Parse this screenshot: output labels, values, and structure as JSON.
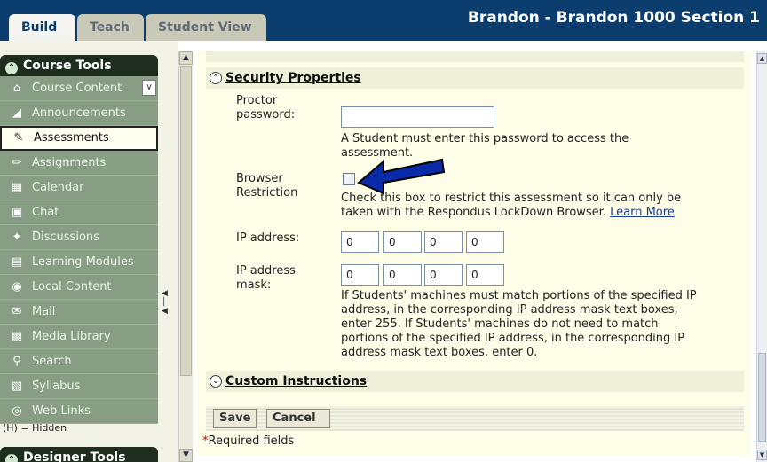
{
  "tabs": [
    {
      "label": "Build"
    },
    {
      "label": "Teach"
    },
    {
      "label": "Student View"
    }
  ],
  "course_title": "Brandon - Brandon 1000 Section 1",
  "sidebar": {
    "header": "Course Tools",
    "items": [
      {
        "label": "Course Content",
        "icon": "home-icon"
      },
      {
        "label": "Announcements",
        "icon": "megaphone-icon"
      },
      {
        "label": "Assessments",
        "icon": "assessment-icon"
      },
      {
        "label": "Assignments",
        "icon": "pencil-icon"
      },
      {
        "label": "Calendar",
        "icon": "calendar-icon"
      },
      {
        "label": "Chat",
        "icon": "chat-icon"
      },
      {
        "label": "Discussions",
        "icon": "pushpin-icon"
      },
      {
        "label": "Learning Modules",
        "icon": "modules-icon"
      },
      {
        "label": "Local Content",
        "icon": "disc-icon"
      },
      {
        "label": "Mail",
        "icon": "mail-icon"
      },
      {
        "label": "Media Library",
        "icon": "media-icon"
      },
      {
        "label": "Search",
        "icon": "magnifier-icon"
      },
      {
        "label": "Syllabus",
        "icon": "syllabus-icon"
      },
      {
        "label": "Web Links",
        "icon": "globe-icon"
      }
    ],
    "active_item": "Assessments",
    "hidden_note": "(H) = Hidden",
    "designer_header": "Designer Tools"
  },
  "security": {
    "header": "Security Properties",
    "proctor_label_1": "Proctor",
    "proctor_label_2": "password:",
    "proctor_value": "",
    "proctor_desc_1": "A Student must enter this password to access the",
    "proctor_desc_2": "assessment.",
    "browser_label_1": "Browser",
    "browser_label_2": "Restriction",
    "browser_checked": false,
    "browser_desc_1": "Check this box to restrict this assessment so it can only be",
    "browser_desc_2": "taken with the Respondus LockDown Browser.",
    "learn_more": "Learn More",
    "ip_label": "IP address:",
    "ip_values": [
      "0",
      "0",
      "0",
      "0"
    ],
    "mask_label_1": "IP address",
    "mask_label_2": "mask:",
    "mask_values": [
      "0",
      "0",
      "0",
      "0"
    ],
    "mask_desc": [
      "If Students' machines must match portions of the specified IP",
      "address, in the corresponding IP address mask text boxes,",
      "enter 255. If Students' machines do not need to match",
      "portions of the specified IP address, in the corresponding IP",
      "address mask text boxes, enter 0."
    ]
  },
  "custom": {
    "header": "Custom Instructions"
  },
  "buttons": {
    "save": "Save",
    "cancel": "Cancel"
  },
  "required": {
    "star": "*",
    "text": "Required fields"
  },
  "colors": {
    "topbar": "#0b3e6f",
    "nav_bg": "#879e85",
    "header_bg": "#1f2d1f",
    "panel": "#fdfde8",
    "arrow": "#0a2aa8"
  }
}
